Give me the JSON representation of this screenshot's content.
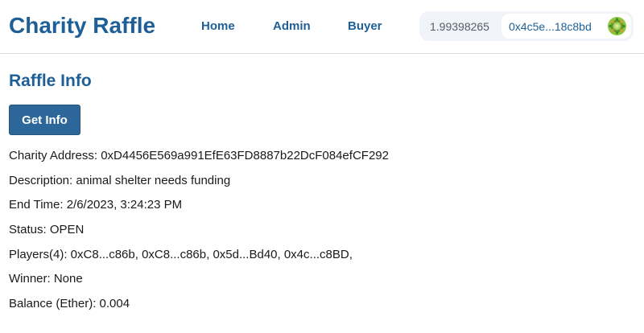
{
  "header": {
    "brand": "Charity Raffle",
    "nav": {
      "home": "Home",
      "admin": "Admin",
      "buyer": "Buyer"
    },
    "wallet": {
      "balance": "1.99398265",
      "address": "0x4c5e...18c8bd",
      "avatar_icon": "identicon-icon"
    }
  },
  "main": {
    "title": "Raffle Info",
    "get_info_label": "Get Info",
    "info": {
      "charity_address": "Charity Address: 0xD4456E569a991EfE63FD8887b22DcF084efCF292",
      "description": "Description: animal shelter needs funding",
      "end_time": "End Time: 2/6/2023, 3:24:23 PM",
      "status": "Status: OPEN",
      "players": "Players(4): 0xC8...c86b, 0xC8...c86b, 0x5d...Bd40, 0x4c...c8BD,",
      "winner": "Winner: None",
      "balance": "Balance (Ether): 0.004"
    }
  },
  "colors": {
    "accent": "#1f5f98",
    "button": "#2d6699",
    "wallet_bg": "#f0f3f7"
  }
}
